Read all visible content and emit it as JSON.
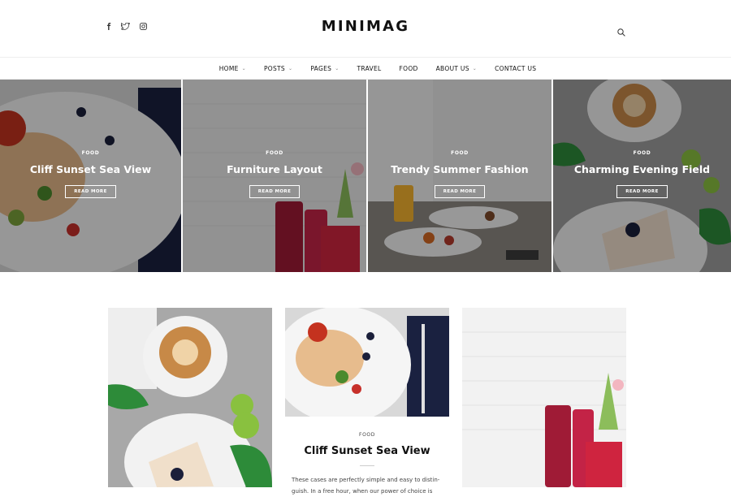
{
  "site": {
    "logo": "MINIMAG"
  },
  "header": {
    "social": [
      "facebook-icon",
      "twitter-icon",
      "instagram-icon"
    ]
  },
  "nav": [
    {
      "label": "HOME",
      "dropdown": true
    },
    {
      "label": "POSTS",
      "dropdown": true
    },
    {
      "label": "PAGES",
      "dropdown": true
    },
    {
      "label": "TRAVEL",
      "dropdown": false
    },
    {
      "label": "FOOD",
      "dropdown": false
    },
    {
      "label": "ABOUT US",
      "dropdown": true
    },
    {
      "label": "CONTACT US",
      "dropdown": false
    }
  ],
  "slides": [
    {
      "category": "FOOD",
      "title": "Cliff Sunset Sea View",
      "button": "READ MORE"
    },
    {
      "category": "FOOD",
      "title": "Furniture Layout",
      "button": "READ MORE"
    },
    {
      "category": "FOOD",
      "title": "Trendy Summer Fashion",
      "button": "READ MORE"
    },
    {
      "category": "FOOD",
      "title": "Charming Evening Field",
      "button": "READ MORE"
    }
  ],
  "featured": {
    "category": "FOOD",
    "title": "Cliff Sunset Sea View",
    "excerpt": "These cases are perfectly simple and easy to distin- guish. In a free hour, when our power of choice is"
  }
}
